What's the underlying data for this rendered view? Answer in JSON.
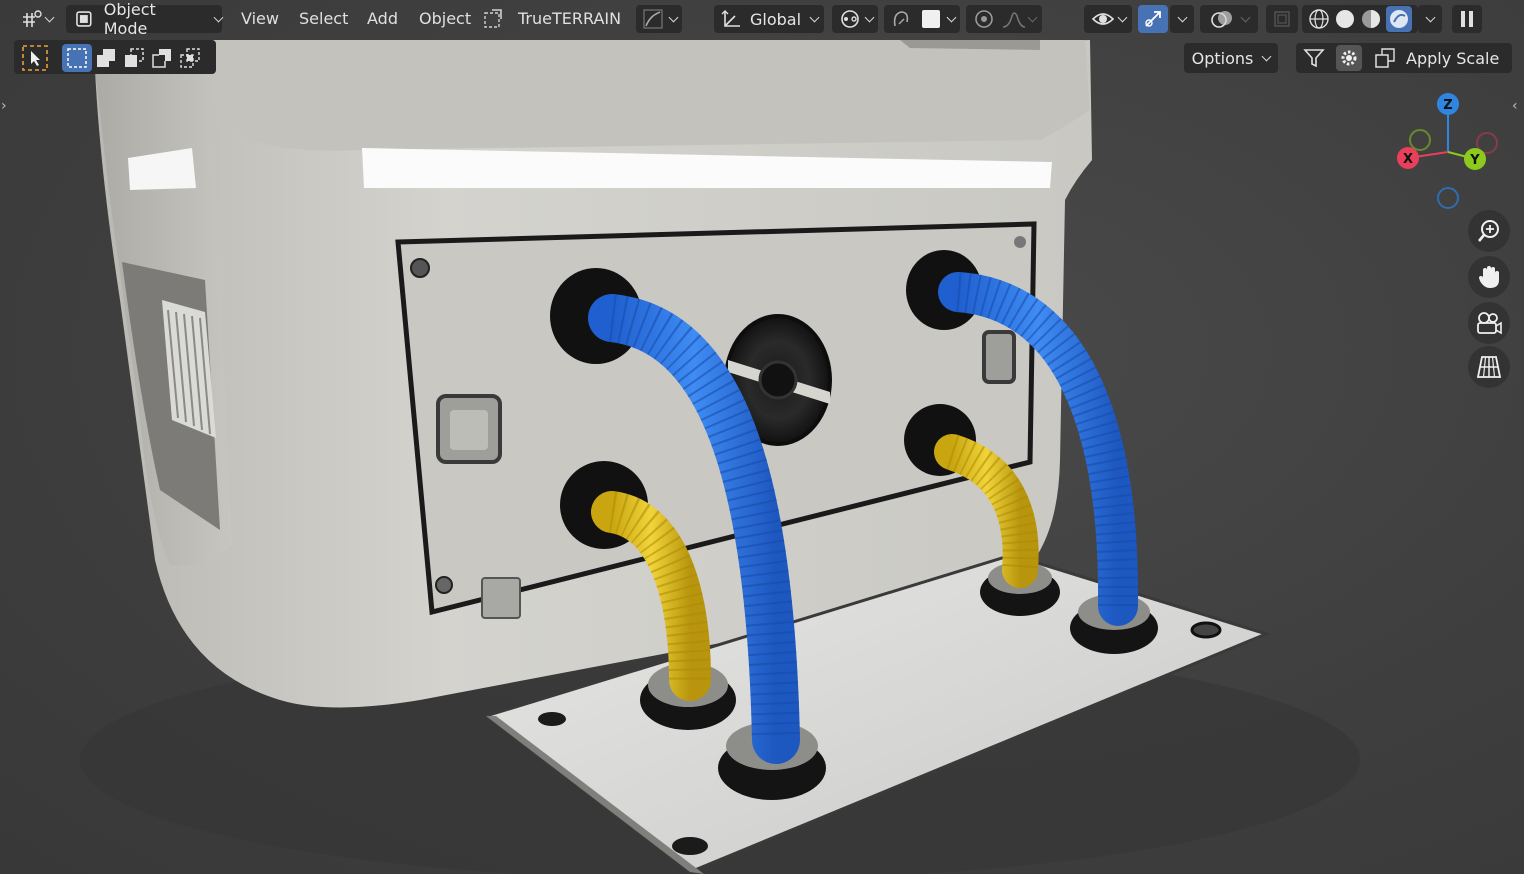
{
  "header": {
    "mode_label": "Object Mode",
    "menus": [
      "View",
      "Select",
      "Add",
      "Object"
    ],
    "addon_label": "TrueTERRAIN",
    "transform_orientation": "Global"
  },
  "tool_header": {
    "options_label": "Options",
    "apply_scale_label": "Apply Scale"
  },
  "gizmo": {
    "axes": {
      "x": "X",
      "y": "Y",
      "z": "Z"
    },
    "colors": {
      "x": "#e8405a",
      "y": "#8ccb1e",
      "z": "#2f86e0"
    }
  },
  "icons": {
    "editor_type": "editor-type-icon",
    "mode": "object-mode-icon",
    "select_box": "select-box-icon",
    "navigation": [
      "zoom-icon",
      "hand-pan-icon",
      "camera-icon",
      "ortho-grid-icon"
    ],
    "shading": [
      "wireframe-shading-icon",
      "solid-shading-icon",
      "material-shading-icon",
      "rendered-shading-icon"
    ]
  },
  "scene": {
    "object_color_main": "#cfcdc7",
    "hose_blue": "#2f78e8",
    "hose_yellow": "#e6c41e"
  }
}
